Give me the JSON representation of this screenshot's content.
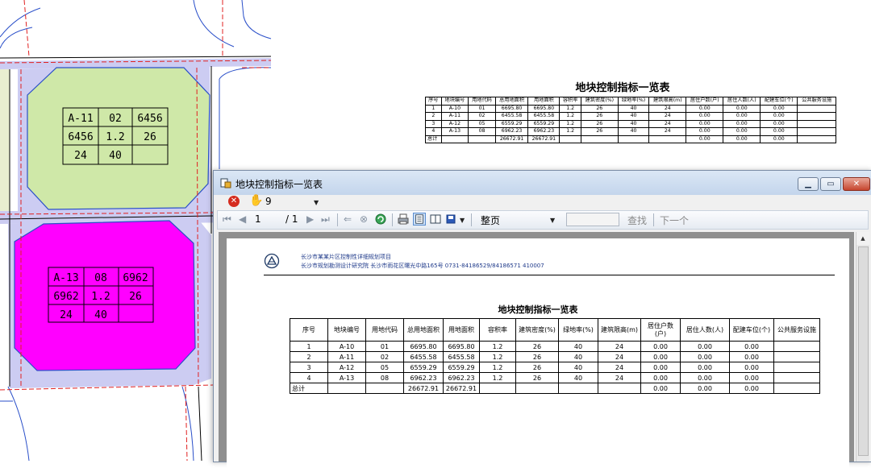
{
  "cad_labels": {
    "block_a11": [
      "A-11",
      "02",
      "6456",
      "6456",
      "1.2",
      "26",
      "24",
      "40",
      ""
    ],
    "block_a13": [
      "A-13",
      "08",
      "6962",
      "6962",
      "1.2",
      "26",
      "24",
      "40",
      ""
    ]
  },
  "background_table": {
    "title": "地块控制指标一览表",
    "headers": [
      "序号",
      "地块编号",
      "用地代码",
      "总用地面积",
      "用地面积",
      "容积率",
      "建筑密度(%)",
      "绿地率(%)",
      "建筑限高(m)",
      "居住户数(户)",
      "居住人数(人)",
      "配建车位(个)",
      "公共服务设施"
    ],
    "rows": [
      [
        "1",
        "A-10",
        "01",
        "6695.80",
        "6695.80",
        "1.2",
        "26",
        "40",
        "24",
        "0.00",
        "0.00",
        "0.00",
        ""
      ],
      [
        "2",
        "A-11",
        "02",
        "6455.58",
        "6455.58",
        "1.2",
        "26",
        "40",
        "24",
        "0.00",
        "0.00",
        "0.00",
        ""
      ],
      [
        "3",
        "A-12",
        "05",
        "6559.29",
        "6559.29",
        "1.2",
        "26",
        "40",
        "24",
        "0.00",
        "0.00",
        "0.00",
        ""
      ],
      [
        "4",
        "A-13",
        "08",
        "6962.23",
        "6962.23",
        "1.2",
        "26",
        "40",
        "24",
        "0.00",
        "0.00",
        "0.00",
        ""
      ]
    ],
    "total_row": [
      "总计",
      "",
      "",
      "26672.91",
      "26672.91",
      "",
      "",
      "",
      "",
      "0.00",
      "0.00",
      "0.00",
      ""
    ]
  },
  "window": {
    "title": "地块控制指标一览表",
    "toolbar": {
      "zoom_value": "9"
    },
    "nav": {
      "current_page": "1",
      "total_pages": "/ 1",
      "fit_mode": "整页",
      "find_label": "查找",
      "next_label": "下一个"
    }
  },
  "report": {
    "header_line1": "长沙市某某片区控制性详细规划项目",
    "header_line2": "长沙市规划勘测设计研究院    长沙市雨花区曙光中路165号    0731-84186529/84186571    410007",
    "title": "地块控制指标一览表",
    "headers": [
      "序号",
      "地块编号",
      "用地代码",
      "总用地面积",
      "用地面积",
      "容积率",
      "建筑密度(%)",
      "绿地率(%)",
      "建筑限高(m)",
      "居住户数(户)",
      "居住人数(人)",
      "配建车位(个)",
      "公共服务设施"
    ],
    "rows": [
      [
        "1",
        "A-10",
        "01",
        "6695.80",
        "6695.80",
        "1.2",
        "26",
        "40",
        "24",
        "0.00",
        "0.00",
        "0.00",
        ""
      ],
      [
        "2",
        "A-11",
        "02",
        "6455.58",
        "6455.58",
        "1.2",
        "26",
        "40",
        "24",
        "0.00",
        "0.00",
        "0.00",
        ""
      ],
      [
        "3",
        "A-12",
        "05",
        "6559.29",
        "6559.29",
        "1.2",
        "26",
        "40",
        "24",
        "0.00",
        "0.00",
        "0.00",
        ""
      ],
      [
        "4",
        "A-13",
        "08",
        "6962.23",
        "6962.23",
        "1.2",
        "26",
        "40",
        "24",
        "0.00",
        "0.00",
        "0.00",
        ""
      ]
    ],
    "total_row": [
      "总计",
      "",
      "",
      "26672.91",
      "26672.91",
      "",
      "",
      "",
      "",
      "0.00",
      "0.00",
      "0.00",
      ""
    ]
  },
  "colors": {
    "parcel_green": "#cfe8a8",
    "parcel_magenta": "#ff00ff",
    "parcel_lavender": "#ccccf2",
    "boundary_red": "#e02020",
    "road_blue": "#2a4fc9"
  }
}
